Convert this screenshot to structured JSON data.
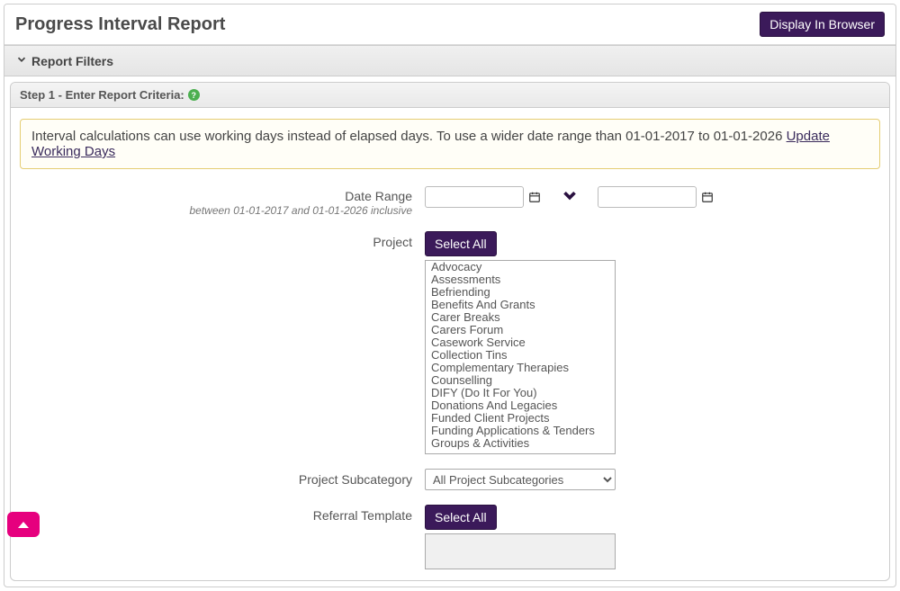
{
  "header": {
    "title": "Progress Interval Report",
    "display_button": "Display In Browser"
  },
  "filters_bar": {
    "label": "Report Filters"
  },
  "step1": {
    "title": "Step 1 - Enter Report Criteria:",
    "notice_text": "Interval calculations can use working days instead of elapsed days. To use a wider date range than 01-01-2017 to 01-01-2026 ",
    "notice_link": "Update Working Days",
    "date_range_label": "Date Range",
    "date_range_sublabel": "between 01-01-2017 and 01-01-2026 inclusive",
    "project_label": "Project",
    "select_all_label": "Select All",
    "project_items": [
      "Advocacy",
      "Assessments",
      "Befriending",
      "Benefits And Grants",
      "Carer Breaks",
      "Carers Forum",
      "Casework Service",
      "Collection Tins",
      "Complementary Therapies",
      "Counselling",
      "DIFY (Do It For You)",
      "Donations And Legacies",
      "Funded Client Projects",
      "Funding Applications &amp; Tenders",
      "Groups &amp; Activities"
    ],
    "subcategory_label": "Project Subcategory",
    "subcategory_selected": "All Project Subcategories",
    "referral_label": "Referral Template"
  }
}
